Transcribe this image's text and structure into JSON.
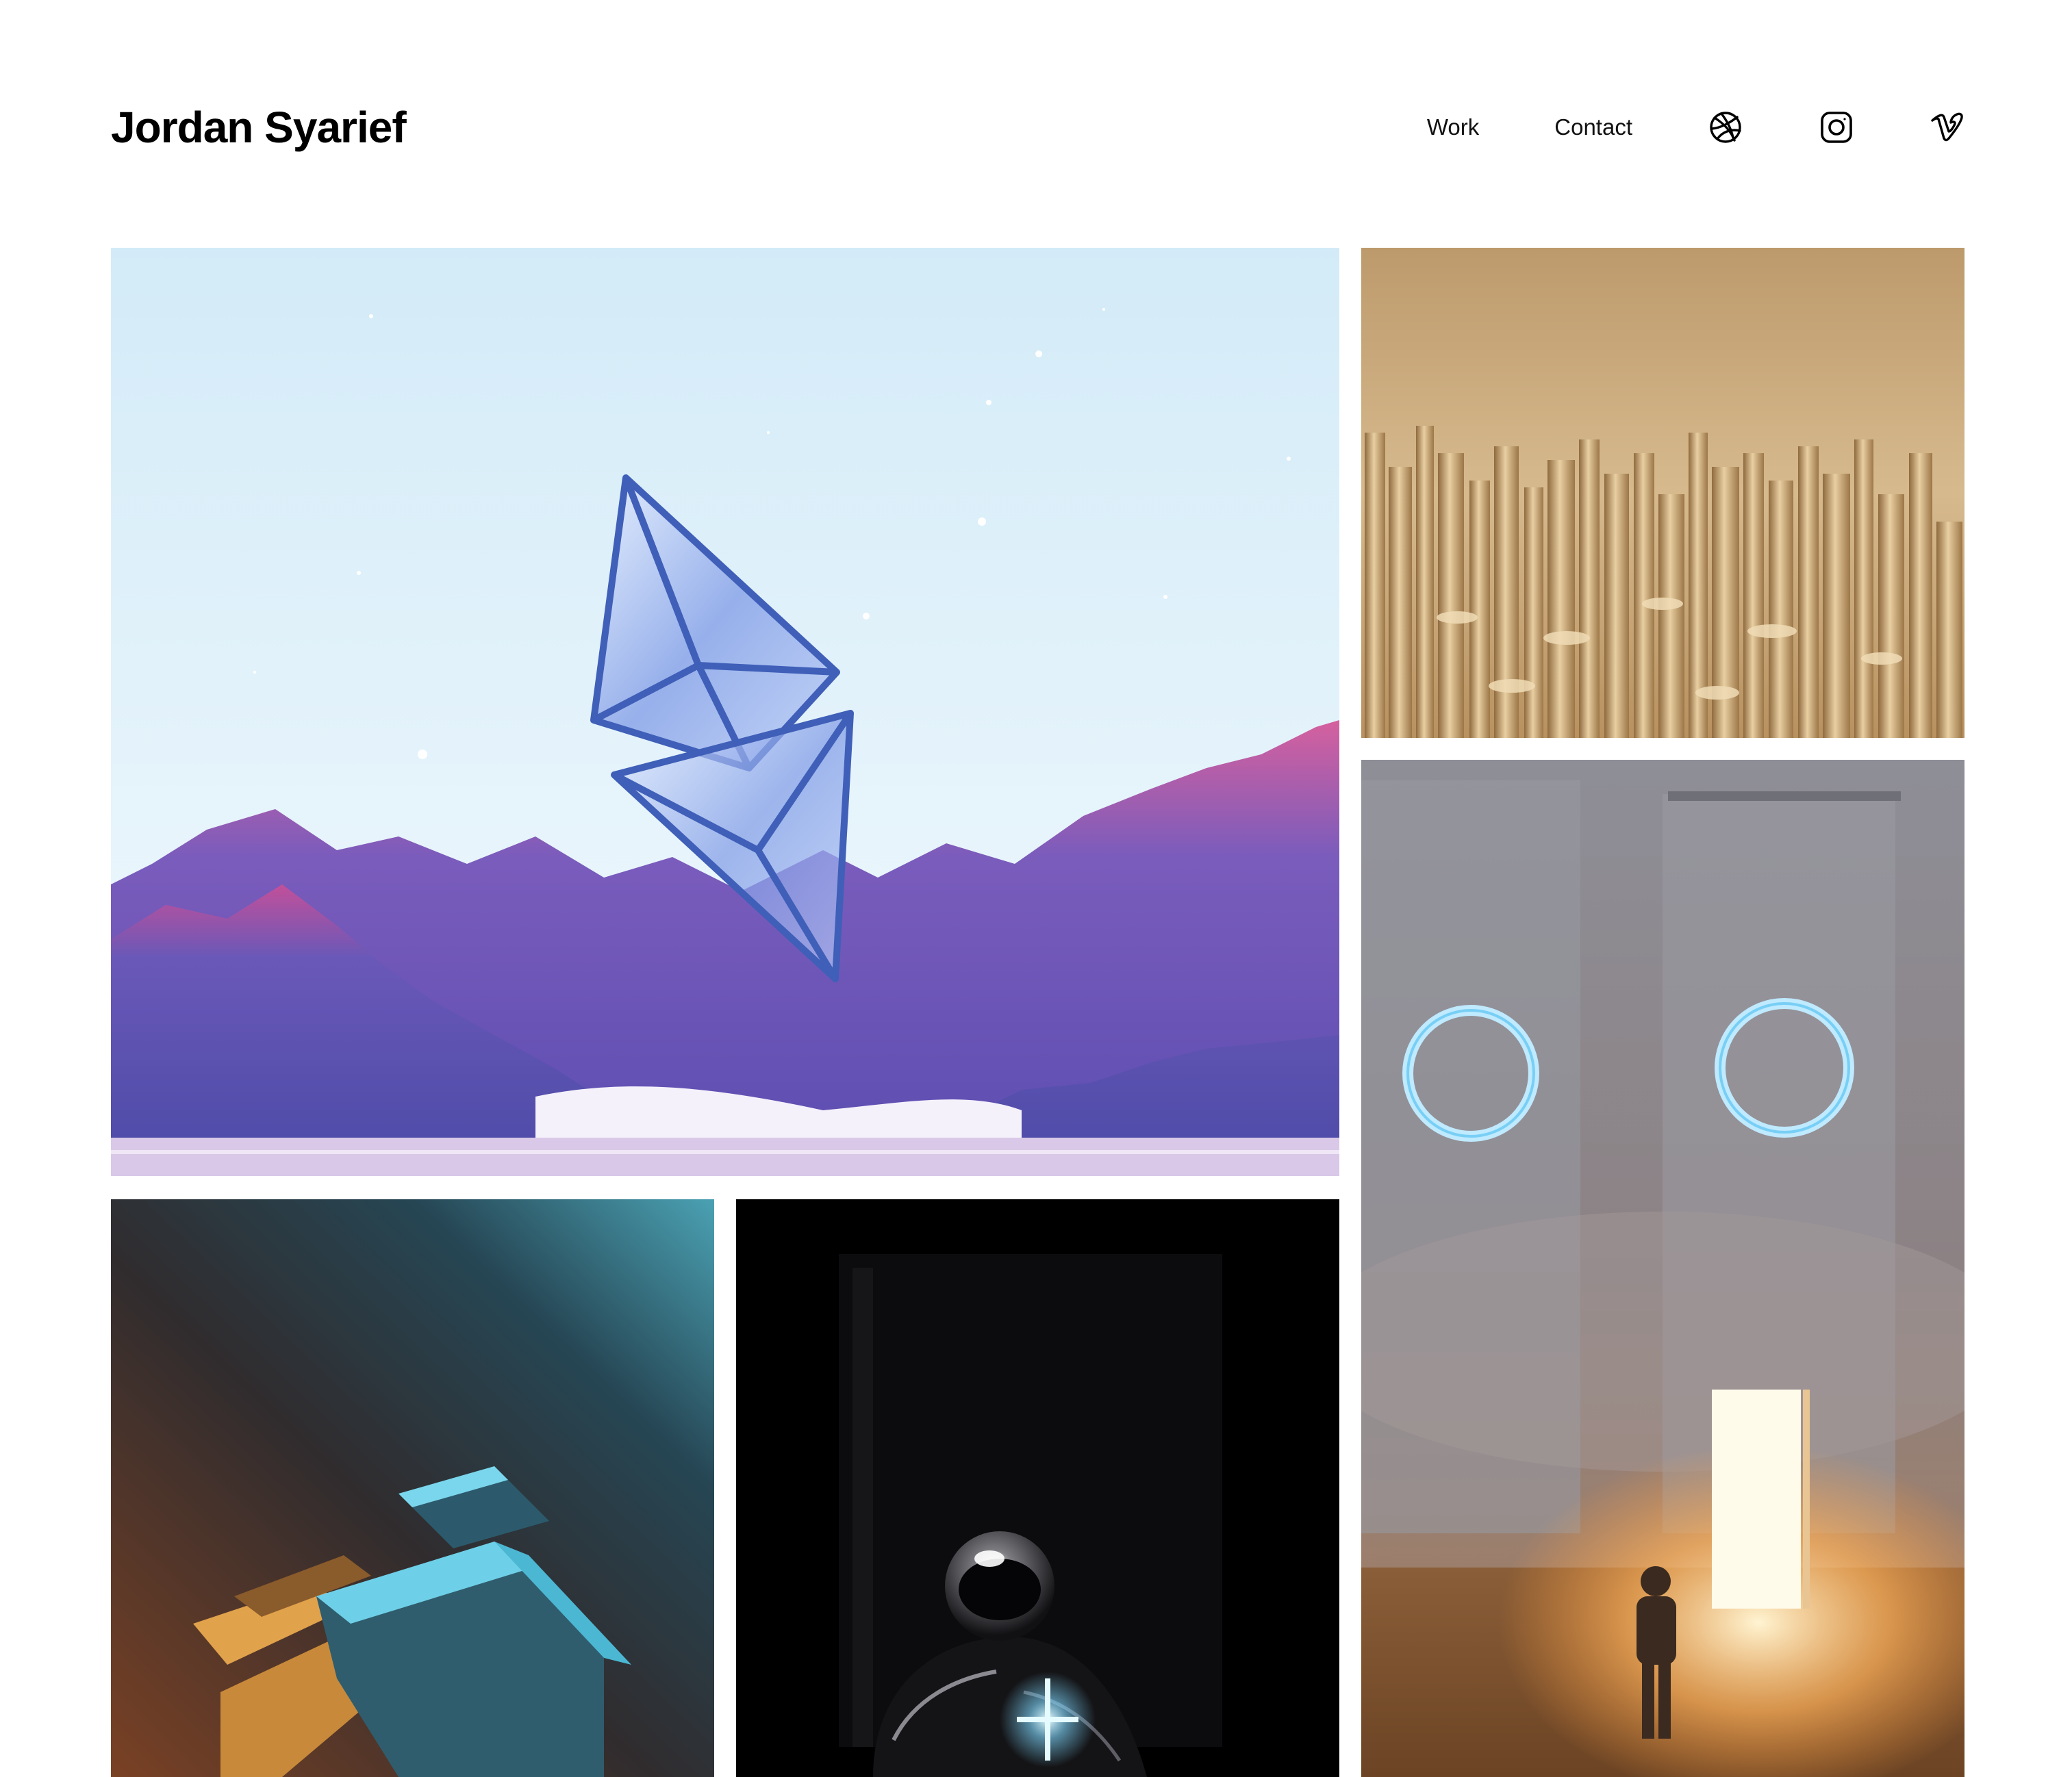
{
  "header": {
    "site_title": "Jordan Syarief",
    "nav": {
      "work_label": "Work",
      "contact_label": "Contact",
      "icons": [
        "dribbble-icon",
        "instagram-icon",
        "vimeo-icon"
      ]
    }
  },
  "gallery": {
    "artworks": [
      {
        "subject": "glass-ethereum-crystal-over-purple-mountains"
      },
      {
        "subject": "golden-cylinders-with-letters"
      },
      {
        "subject": "glowing-rings-and-portal-door"
      },
      {
        "subject": "blue-and-orange-cubes"
      },
      {
        "subject": "astronaut-in-dark-room"
      }
    ]
  },
  "colors": {
    "background": "#ffffff",
    "title_text": "#000000",
    "nav_text": "#111111"
  }
}
